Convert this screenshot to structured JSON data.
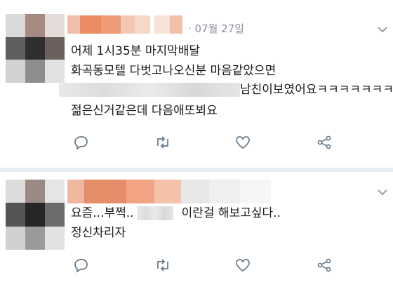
{
  "tweets": [
    {
      "date": "· 07월 27일",
      "avatar_colors": [
        "#d9d9d9",
        "#a58a82",
        "#e4dcd9",
        "#5f5f5f",
        "#2f2f2f",
        "#6b605c",
        "#d2d2d2",
        "#8d8d8d",
        "#e1e1e1"
      ],
      "name_colors": [
        "#f1bfa8",
        "#e98b63",
        "#ee9b77",
        "#f3c7b3",
        "#f6d8c9",
        "#ffffff",
        "#f9e2d6",
        "#f2c0a9"
      ],
      "lines": [
        "어제 1시35분 마지막배달",
        "화곡동모텔 다벗고나오신분 마음같았으면",
        "남친이보였어요ㅋㅋㅋㅋㅋㅋㅋ",
        "젊은신거같은데 다음애또뵈요"
      ],
      "icons": [
        "reply-icon",
        "retweet-icon",
        "like-icon",
        "share-icon"
      ]
    },
    {
      "avatar_colors": [
        "#dcdcdc",
        "#9b8a84",
        "#e5e5e5",
        "#555555",
        "#262626",
        "#6c6c6c",
        "#d0d0d0",
        "#9a9a9a",
        "#e2e2e2"
      ],
      "name_colors": [
        "#f0b79f",
        "#e58d68",
        "#f1a383",
        "#f4c1a9",
        "#e7e7e7",
        "#efefef",
        "#f6f6f6"
      ],
      "line1_start": "요즘...부쩍..",
      "line1_end": "이란걸 해보고싶다..",
      "line2": "정신차리자",
      "icons": [
        "reply-icon",
        "retweet-icon",
        "like-icon",
        "share-icon"
      ]
    }
  ]
}
